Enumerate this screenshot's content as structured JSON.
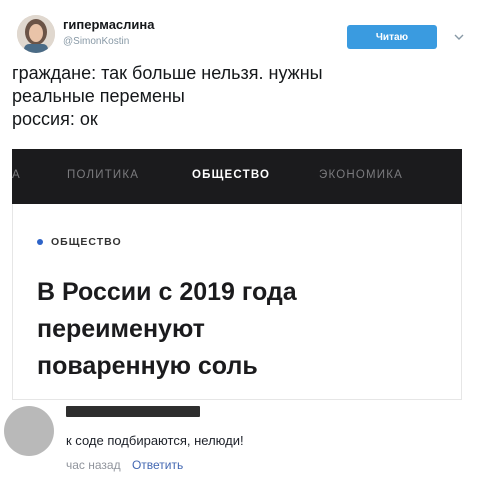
{
  "tweet": {
    "display_name": "гипермаслина",
    "handle": "@SimonKostin",
    "follow_label": "Читаю",
    "lines": [
      "граждане: так больше нельзя. нужны",
      "реальные перемены",
      "россия: ок"
    ]
  },
  "news_card": {
    "nav_tabs": [
      "А",
      "ПОЛИТИКА",
      "ОБЩЕСТВО",
      "ЭКОНОМИКА"
    ],
    "active_tab": "ОБЩЕСТВО",
    "section_label": "ОБЩЕСТВО",
    "headline_lines": [
      "В России с 2019 года",
      "переименуют",
      "поваренную соль"
    ]
  },
  "reply": {
    "author_name": "",
    "text": "к соде подбираются, нелюди!",
    "time": "час назад",
    "action_label": "Ответить"
  },
  "colors": {
    "follow_button": "#3a9be0",
    "nav_background": "#1b1b1d",
    "section_dot": "#2d63c8",
    "reply_action": "#4267b2"
  },
  "icons": [
    "avatar",
    "chevron-down-icon",
    "section-dot-icon",
    "reply-avatar"
  ]
}
